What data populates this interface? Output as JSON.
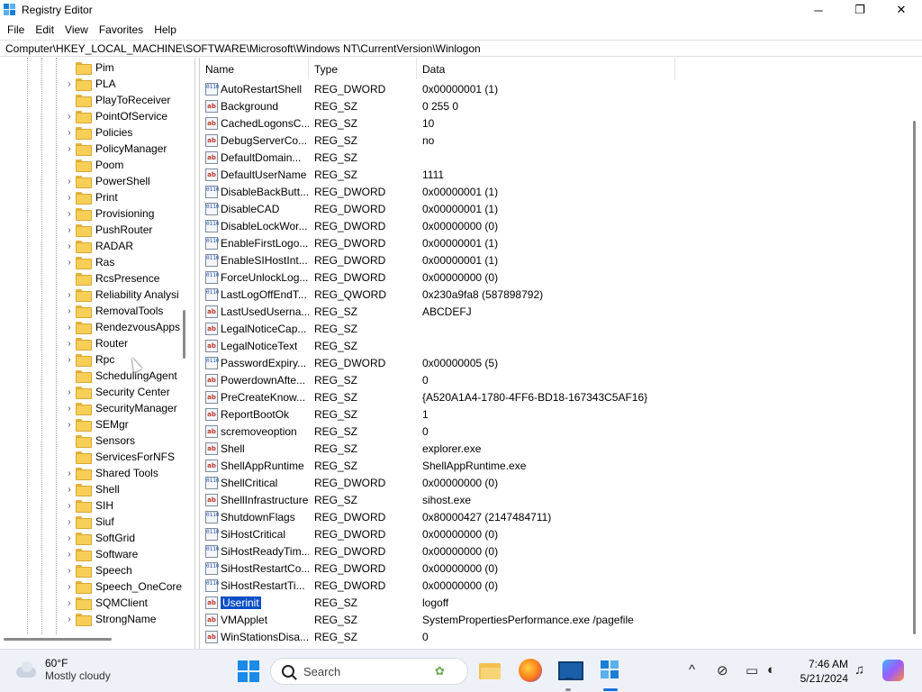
{
  "window": {
    "title": "Registry Editor",
    "minimize": "─",
    "maximize": "❐",
    "close": "✕"
  },
  "menu": [
    "File",
    "Edit",
    "View",
    "Favorites",
    "Help"
  ],
  "address": "Computer\\HKEY_LOCAL_MACHINE\\SOFTWARE\\Microsoft\\Windows NT\\CurrentVersion\\Winlogon",
  "tree": {
    "items": [
      {
        "label": "Pim",
        "expandable": false
      },
      {
        "label": "PLA",
        "expandable": true
      },
      {
        "label": "PlayToReceiver",
        "expandable": false
      },
      {
        "label": "PointOfService",
        "expandable": true
      },
      {
        "label": "Policies",
        "expandable": true
      },
      {
        "label": "PolicyManager",
        "expandable": true
      },
      {
        "label": "Poom",
        "expandable": false
      },
      {
        "label": "PowerShell",
        "expandable": true
      },
      {
        "label": "Print",
        "expandable": true
      },
      {
        "label": "Provisioning",
        "expandable": true
      },
      {
        "label": "PushRouter",
        "expandable": true
      },
      {
        "label": "RADAR",
        "expandable": true
      },
      {
        "label": "Ras",
        "expandable": true
      },
      {
        "label": "RcsPresence",
        "expandable": false
      },
      {
        "label": "Reliability Analysi",
        "expandable": true
      },
      {
        "label": "RemovalTools",
        "expandable": true
      },
      {
        "label": "RendezvousApps",
        "expandable": true
      },
      {
        "label": "Router",
        "expandable": true
      },
      {
        "label": "Rpc",
        "expandable": true
      },
      {
        "label": "SchedulingAgent",
        "expandable": false
      },
      {
        "label": "Security Center",
        "expandable": true
      },
      {
        "label": "SecurityManager",
        "expandable": true
      },
      {
        "label": "SEMgr",
        "expandable": true
      },
      {
        "label": "Sensors",
        "expandable": false
      },
      {
        "label": "ServicesForNFS",
        "expandable": false
      },
      {
        "label": "Shared Tools",
        "expandable": true
      },
      {
        "label": "Shell",
        "expandable": true
      },
      {
        "label": "SIH",
        "expandable": true
      },
      {
        "label": "Siuf",
        "expandable": true
      },
      {
        "label": "SoftGrid",
        "expandable": true
      },
      {
        "label": "Software",
        "expandable": true
      },
      {
        "label": "Speech",
        "expandable": true
      },
      {
        "label": "Speech_OneCore",
        "expandable": true
      },
      {
        "label": "SQMClient",
        "expandable": true
      },
      {
        "label": "StrongName",
        "expandable": true
      }
    ]
  },
  "values": {
    "headers": {
      "name": "Name",
      "type": "Type",
      "data": "Data"
    },
    "rows": [
      {
        "name": "AutoRestartShell",
        "type": "REG_DWORD",
        "data": "0x00000001 (1)",
        "kind": "bin"
      },
      {
        "name": "Background",
        "type": "REG_SZ",
        "data": "0 255 0",
        "kind": "sz"
      },
      {
        "name": "CachedLogonsC...",
        "type": "REG_SZ",
        "data": "10",
        "kind": "sz"
      },
      {
        "name": "DebugServerCo...",
        "type": "REG_SZ",
        "data": "no",
        "kind": "sz"
      },
      {
        "name": "DefaultDomain...",
        "type": "REG_SZ",
        "data": "",
        "kind": "sz"
      },
      {
        "name": "DefaultUserName",
        "type": "REG_SZ",
        "data": "1111",
        "kind": "sz"
      },
      {
        "name": "DisableBackButt...",
        "type": "REG_DWORD",
        "data": "0x00000001 (1)",
        "kind": "bin"
      },
      {
        "name": "DisableCAD",
        "type": "REG_DWORD",
        "data": "0x00000001 (1)",
        "kind": "bin"
      },
      {
        "name": "DisableLockWor...",
        "type": "REG_DWORD",
        "data": "0x00000000 (0)",
        "kind": "bin"
      },
      {
        "name": "EnableFirstLogo...",
        "type": "REG_DWORD",
        "data": "0x00000001 (1)",
        "kind": "bin"
      },
      {
        "name": "EnableSIHostInt...",
        "type": "REG_DWORD",
        "data": "0x00000001 (1)",
        "kind": "bin"
      },
      {
        "name": "ForceUnlockLog...",
        "type": "REG_DWORD",
        "data": "0x00000000 (0)",
        "kind": "bin"
      },
      {
        "name": "LastLogOffEndT...",
        "type": "REG_QWORD",
        "data": "0x230a9fa8 (587898792)",
        "kind": "bin"
      },
      {
        "name": "LastUsedUserna...",
        "type": "REG_SZ",
        "data": "ABCDEFJ",
        "kind": "sz"
      },
      {
        "name": "LegalNoticeCap...",
        "type": "REG_SZ",
        "data": "",
        "kind": "sz"
      },
      {
        "name": "LegalNoticeText",
        "type": "REG_SZ",
        "data": "",
        "kind": "sz"
      },
      {
        "name": "PasswordExpiry...",
        "type": "REG_DWORD",
        "data": "0x00000005 (5)",
        "kind": "bin"
      },
      {
        "name": "PowerdownAfte...",
        "type": "REG_SZ",
        "data": "0",
        "kind": "sz"
      },
      {
        "name": "PreCreateKnow...",
        "type": "REG_SZ",
        "data": "{A520A1A4-1780-4FF6-BD18-167343C5AF16}",
        "kind": "sz"
      },
      {
        "name": "ReportBootOk",
        "type": "REG_SZ",
        "data": "1",
        "kind": "sz"
      },
      {
        "name": "scremoveoption",
        "type": "REG_SZ",
        "data": "0",
        "kind": "sz"
      },
      {
        "name": "Shell",
        "type": "REG_SZ",
        "data": "explorer.exe",
        "kind": "sz"
      },
      {
        "name": "ShellAppRuntime",
        "type": "REG_SZ",
        "data": "ShellAppRuntime.exe",
        "kind": "sz"
      },
      {
        "name": "ShellCritical",
        "type": "REG_DWORD",
        "data": "0x00000000 (0)",
        "kind": "bin"
      },
      {
        "name": "ShellInfrastructure",
        "type": "REG_SZ",
        "data": "sihost.exe",
        "kind": "sz"
      },
      {
        "name": "ShutdownFlags",
        "type": "REG_DWORD",
        "data": "0x80000427 (2147484711)",
        "kind": "bin"
      },
      {
        "name": "SiHostCritical",
        "type": "REG_DWORD",
        "data": "0x00000000 (0)",
        "kind": "bin"
      },
      {
        "name": "SiHostReadyTim...",
        "type": "REG_DWORD",
        "data": "0x00000000 (0)",
        "kind": "bin"
      },
      {
        "name": "SiHostRestartCo...",
        "type": "REG_DWORD",
        "data": "0x00000000 (0)",
        "kind": "bin"
      },
      {
        "name": "SiHostRestartTi...",
        "type": "REG_DWORD",
        "data": "0x00000000 (0)",
        "kind": "bin"
      },
      {
        "name": "Userinit",
        "type": "REG_SZ",
        "data": "logoff",
        "kind": "sz",
        "selected": true
      },
      {
        "name": "VMApplet",
        "type": "REG_SZ",
        "data": "SystemPropertiesPerformance.exe /pagefile",
        "kind": "sz"
      },
      {
        "name": "WinStationsDisa...",
        "type": "REG_SZ",
        "data": "0",
        "kind": "sz"
      }
    ]
  },
  "taskbar": {
    "weather_temp": "60°F",
    "weather_desc": "Mostly cloudy",
    "search_label": "Search",
    "time": "7:46 AM",
    "date": "5/21/2024",
    "tray_chevron": "^",
    "icons": [
      "start-icon",
      "file-explorer-icon",
      "firefox-icon",
      "monitor-app-icon",
      "regedit-icon",
      "copilot-icon"
    ]
  },
  "colors": {
    "selection": "#0a4fc4",
    "accent": "#1a7fd4",
    "folder": "#f7cf57",
    "taskbar": "#eef2f8"
  }
}
